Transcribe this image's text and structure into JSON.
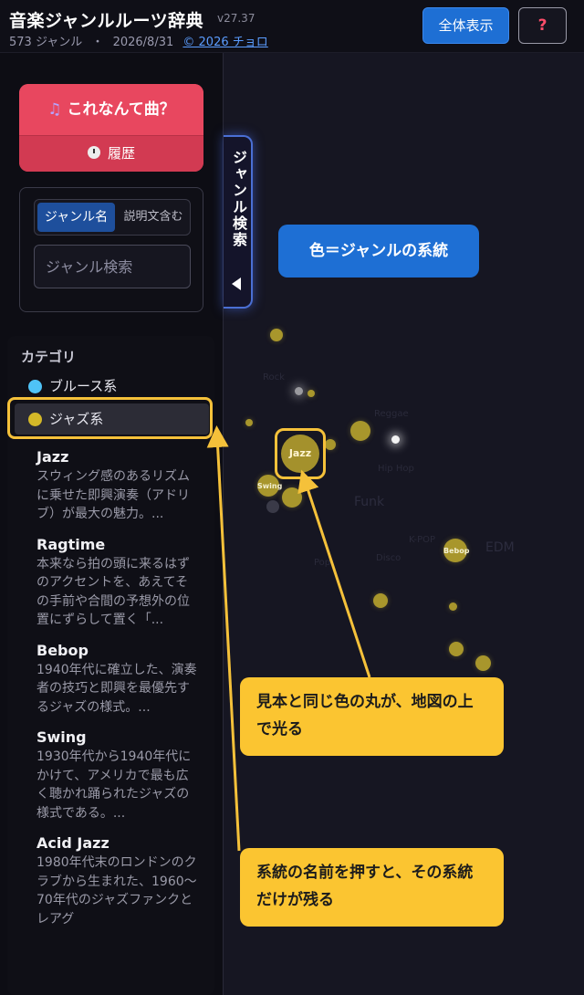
{
  "header": {
    "title": "音楽ジャンルルーツ辞典",
    "version": "v27.37",
    "genre_count": "573 ジャンル",
    "separator": "・",
    "date": "2026/8/31",
    "copyright": "© 2026 チョロ",
    "show_all_label": "全体表示",
    "help_label": "?"
  },
  "quiz": {
    "title": "これなんて曲？",
    "history_label": "履歴",
    "note_icon": "music-note-icon",
    "clock_icon": "clock-icon"
  },
  "search": {
    "mode_name": "ジャンル名",
    "mode_desc": "説明文含む",
    "placeholder": "ジャンル検索",
    "tab_label": "ジャンル検索"
  },
  "categories": {
    "title": "カテゴリ",
    "items": [
      {
        "label": "ブルース系",
        "color": "#4fc3f7"
      },
      {
        "label": "ジャズ系",
        "color": "#d4b828"
      }
    ]
  },
  "genres": [
    {
      "name": "Jazz",
      "desc": "スウィング感のあるリズムに乗せた即興演奏（アドリブ）が最大の魅力。..."
    },
    {
      "name": "Ragtime",
      "desc": "本来なら拍の頭に来るはずのアクセントを、あえてその手前や合間の予想外の位置にずらして置く「..."
    },
    {
      "name": "Bebop",
      "desc": "1940年代に確立した、演奏者の技巧と即興を最優先するジャズの様式。..."
    },
    {
      "name": "Swing",
      "desc": "1930年代から1940年代にかけて、アメリカで最も広く聴かれ踊られたジャズの様式である。..."
    },
    {
      "name": "Acid Jazz",
      "desc": "1980年代末のロンドンのクラブから生まれた、1960〜70年代のジャズファンクとレアグ"
    }
  ],
  "map": {
    "dots": [
      {
        "label": "Jazz"
      },
      {
        "label": "Swing"
      },
      {
        "label": "Bebop"
      }
    ],
    "faint_words": [
      "Funk",
      "Disco",
      "EDM",
      "K-POP",
      "Reggae",
      "Hip Hop",
      "Pop",
      "Rock"
    ]
  },
  "callouts": {
    "color_legend": "色＝ジャンルの系統",
    "glow_hint": "見本と同じ色の丸が、地図の上で光る",
    "filter_hint": "系統の名前を押すと、その系統だけが残る"
  },
  "colors": {
    "accent_blue": "#1e6fd4",
    "quiz_red": "#e8475f",
    "highlight_yellow": "#f5c13a",
    "jazz": "#a8962c",
    "blues": "#4fc3f7"
  }
}
